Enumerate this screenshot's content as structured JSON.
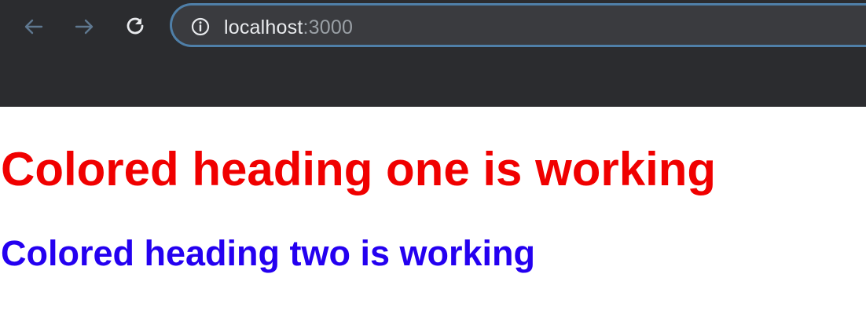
{
  "browser": {
    "url_host": "localhost",
    "url_port": ":3000",
    "colors": {
      "chrome_background": "#2b2c2f",
      "omnibox_background": "#3a3b3f",
      "omnibox_border": "#4f7fa8",
      "url_text": "#e8eaed",
      "url_port_text": "#9aa0a6"
    },
    "icons": {
      "back": "arrow-left-icon",
      "forward": "arrow-right-icon",
      "reload": "reload-icon",
      "site_info": "info-icon"
    }
  },
  "page": {
    "heading_one": "Colored heading one is working",
    "heading_two": "Colored heading two is working",
    "colors": {
      "heading_one": "#f00000",
      "heading_two": "#2400f0",
      "background": "#ffffff"
    }
  }
}
